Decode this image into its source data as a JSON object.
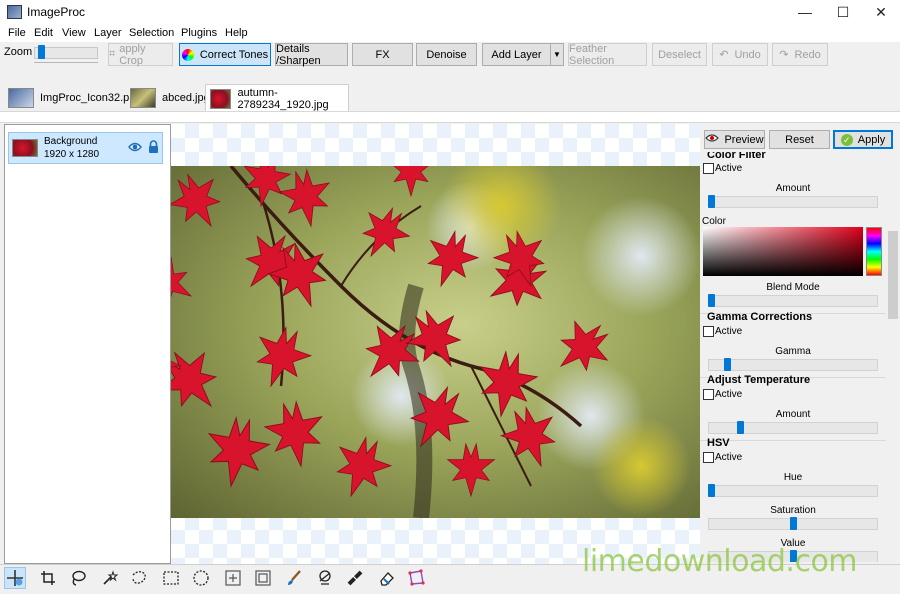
{
  "window": {
    "title": "ImageProc",
    "minimize": "—",
    "maximize": "☐",
    "close": "✕"
  },
  "menu": [
    "File",
    "Edit",
    "View",
    "Layer",
    "Selection",
    "Plugins",
    "Help"
  ],
  "toolbar": {
    "zoom_label": "Zoom",
    "zoom_level_fraction": 0.07,
    "apply_crop": "apply Crop",
    "correct_tones": "Correct Tones",
    "details_sharpen": "Details /Sharpen",
    "fx": "FX",
    "denoise": "Denoise",
    "add_layer": "Add Layer",
    "feather_selection": "Feather Selection",
    "deselect": "Deselect",
    "undo": "Undo",
    "redo": "Redo"
  },
  "tabs": [
    {
      "label": "ImgProc_Icon32.png",
      "active": false
    },
    {
      "label": "abced.jpg",
      "active": false
    },
    {
      "label": "autumn-2789234_1920.jpg",
      "active": true
    }
  ],
  "layers": [
    {
      "name": "Background",
      "size": "1920 x 1280",
      "visible_icon": "eye-icon",
      "lock_icon": "lock-icon"
    }
  ],
  "actions": {
    "preview": "Preview",
    "reset": "Reset",
    "apply": "Apply"
  },
  "adjustments": {
    "color_filter": {
      "title": "Color Filter",
      "active_label": "Active",
      "amount_label": "Amount",
      "amount_value": 0.0,
      "color_label": "Color",
      "blend_mode_label": "Blend Mode",
      "blend_value": 0.0
    },
    "gamma": {
      "title": "Gamma Corrections",
      "active_label": "Active",
      "gamma_label": "Gamma",
      "gamma_value": 0.1
    },
    "temperature": {
      "title": "Adjust Temperature",
      "active_label": "Active",
      "amount_label": "Amount",
      "amount_value": 0.18
    },
    "hsv": {
      "title": "HSV",
      "active_label": "Active",
      "hue_label": "Hue",
      "hue_value": 0.0,
      "saturation_label": "Saturation",
      "saturation_value": 0.5,
      "value_label": "Value",
      "value_value": 0.5
    }
  },
  "tools": [
    "move-tool-icon",
    "crop-tool-icon",
    "lasso-tool-icon",
    "magic-lasso-icon",
    "freeform-select-icon",
    "rect-select-icon",
    "ellipse-select-icon",
    "transform-icon",
    "resize-icon",
    "brush-icon",
    "clone-stamp-icon",
    "healing-icon",
    "eraser-icon",
    "polygon-select-icon"
  ],
  "watermark": "limedownload.com",
  "colors": {
    "accent": "#0078d7",
    "watermark": "#8dc63f"
  }
}
